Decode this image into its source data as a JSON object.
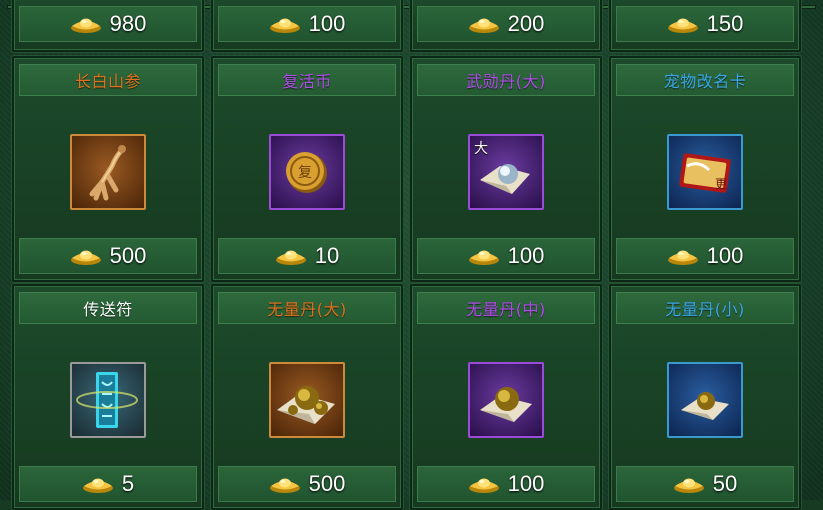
{
  "top_row_prices": [
    "980",
    "100",
    "200",
    "150"
  ],
  "items": [
    {
      "name": "长白山参",
      "name_color": "#e0701c",
      "price": "500",
      "icon": "ginseng-icon",
      "rarity": "orange"
    },
    {
      "name": "复活币",
      "name_color": "#b04ae8",
      "price": "10",
      "icon": "revive-coin-icon",
      "rarity": "purple"
    },
    {
      "name": "武勋丹(大)",
      "name_color": "#b04ae8",
      "price": "100",
      "icon": "merit-pill-icon",
      "rarity": "purple",
      "badge": "大"
    },
    {
      "name": "宠物改名卡",
      "name_color": "#3aa6e6",
      "price": "100",
      "icon": "pet-rename-card-icon",
      "rarity": "blue"
    },
    {
      "name": "传送符",
      "name_color": "#ffffff",
      "price": "5",
      "icon": "teleport-talisman-icon",
      "rarity": "grey"
    },
    {
      "name": "无量丹(大)",
      "name_color": "#e0701c",
      "price": "500",
      "icon": "infinity-pill-icon",
      "rarity": "orange"
    },
    {
      "name": "无量丹(中)",
      "name_color": "#b04ae8",
      "price": "100",
      "icon": "infinity-pill-icon",
      "rarity": "purple"
    },
    {
      "name": "无量丹(小)",
      "name_color": "#3aa6e6",
      "price": "50",
      "icon": "infinity-pill-icon",
      "rarity": "blue"
    }
  ]
}
